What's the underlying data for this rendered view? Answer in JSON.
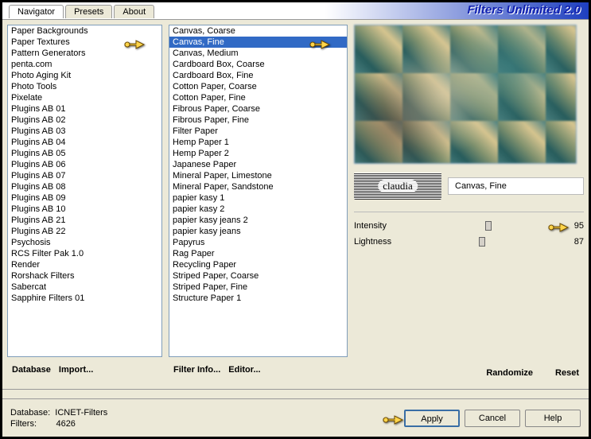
{
  "title": "Filters Unlimited 2.0",
  "tabs": [
    "Navigator",
    "Presets",
    "About"
  ],
  "activeTab": 0,
  "col1": {
    "items": [
      "Paper Backgrounds",
      "Paper Textures",
      "Pattern Generators",
      "penta.com",
      "Photo Aging Kit",
      "Photo Tools",
      "Pixelate",
      "Plugins AB 01",
      "Plugins AB 02",
      "Plugins AB 03",
      "Plugins AB 04",
      "Plugins AB 05",
      "Plugins AB 06",
      "Plugins AB 07",
      "Plugins AB 08",
      "Plugins AB 09",
      "Plugins AB 10",
      "Plugins AB 21",
      "Plugins AB 22",
      "Psychosis",
      "RCS Filter Pak 1.0",
      "Render",
      "Rorshack Filters",
      "Sabercat",
      "Sapphire Filters 01"
    ],
    "selected": 1,
    "buttons": {
      "database": "Database",
      "import": "Import..."
    }
  },
  "col2": {
    "items": [
      "Canvas, Coarse",
      "Canvas, Fine",
      "Canvas, Medium",
      "Cardboard Box, Coarse",
      "Cardboard Box, Fine",
      "Cotton Paper, Coarse",
      "Cotton Paper, Fine",
      "Fibrous Paper, Coarse",
      "Fibrous Paper, Fine",
      "Filter Paper",
      "Hemp Paper 1",
      "Hemp Paper 2",
      "Japanese Paper",
      "Mineral Paper, Limestone",
      "Mineral Paper, Sandstone",
      "papier kasy 1",
      "papier kasy 2",
      "papier kasy jeans 2",
      "papier kasy jeans",
      "Papyrus",
      "Rag Paper",
      "Recycling Paper",
      "Striped Paper, Coarse",
      "Striped Paper, Fine",
      "Structure Paper 1"
    ],
    "selected": 1,
    "buttons": {
      "filterinfo": "Filter Info...",
      "editor": "Editor..."
    }
  },
  "currentFilter": "Canvas, Fine",
  "sliders": [
    {
      "label": "Intensity",
      "value": 95,
      "pos": 50
    },
    {
      "label": "Lightness",
      "value": 87,
      "pos": 46
    }
  ],
  "btmButtons": {
    "randomize": "Randomize",
    "reset": "Reset"
  },
  "footer": {
    "dbLabel": "Database:",
    "dbValue": "ICNET-Filters",
    "filtersLabel": "Filters:",
    "filtersValue": "4626",
    "apply": "Apply",
    "cancel": "Cancel",
    "help": "Help"
  }
}
